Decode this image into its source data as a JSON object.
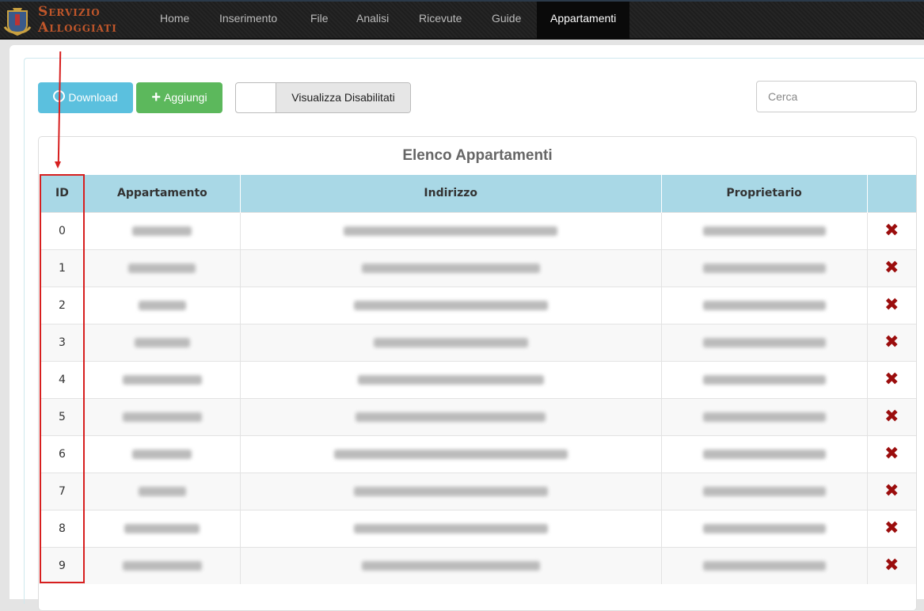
{
  "brand": {
    "line1": "Servizio",
    "line2": "Alloggiati"
  },
  "nav": [
    {
      "label": "Home"
    },
    {
      "label": "Inserimento"
    },
    {
      "label": "File"
    },
    {
      "label": "Analisi"
    },
    {
      "label": "Ricevute"
    },
    {
      "label": "Guide"
    },
    {
      "label": "Appartamenti",
      "active": true
    }
  ],
  "toolbar": {
    "download": "Download",
    "add": "Aggiungi",
    "toggle": "Visualizza Disabilitati",
    "search_placeholder": "Cerca"
  },
  "table": {
    "title": "Elenco Appartamenti",
    "headers": [
      "ID",
      "Appartamento",
      "Indirizzo",
      "Proprietario",
      ""
    ],
    "rows": [
      {
        "id": "0"
      },
      {
        "id": "1"
      },
      {
        "id": "2"
      },
      {
        "id": "3"
      },
      {
        "id": "4"
      },
      {
        "id": "5"
      },
      {
        "id": "6"
      },
      {
        "id": "7"
      },
      {
        "id": "8"
      },
      {
        "id": "9"
      }
    ]
  },
  "colors": {
    "download": "#5bc0de",
    "add": "#5cb85c",
    "header": "#a9d8e6",
    "delete": "#9b0d0d",
    "annotation": "#d71f1f"
  }
}
